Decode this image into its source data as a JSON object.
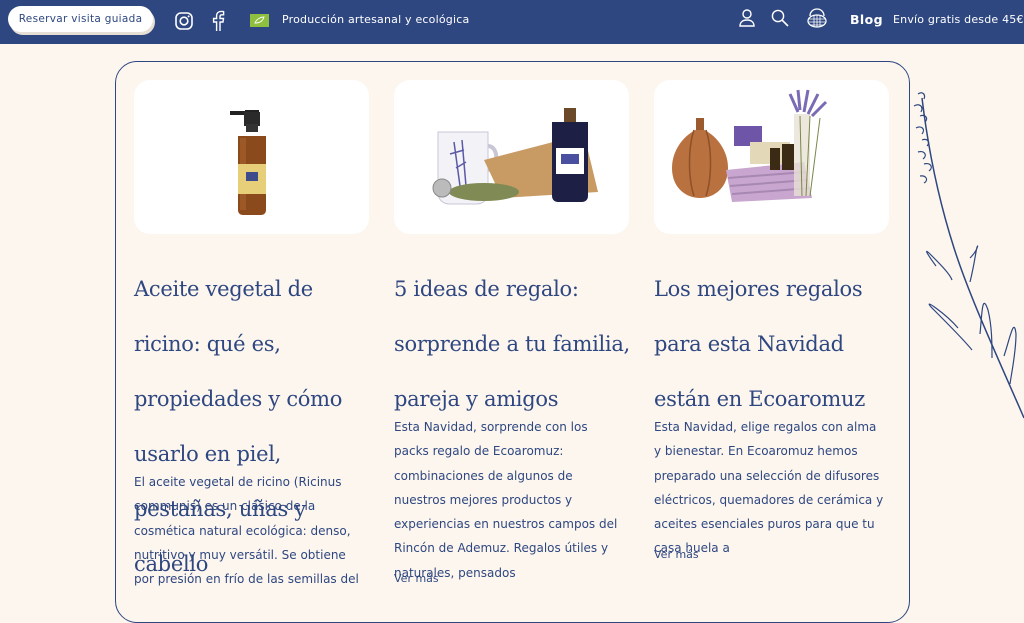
{
  "header": {
    "visit_button": "Reservar visita guiada",
    "tagline": "Producción artesanal y ecológica",
    "blog": "Blog",
    "shipping": "Envío gratis desde 45€",
    "icons": [
      "instagram-icon",
      "facebook-icon",
      "eu-organic-leaf-icon",
      "user-icon",
      "search-icon",
      "basket-icon"
    ]
  },
  "posts": [
    {
      "title": "Aceite vegetal de ricino: qué es, propiedades y cómo usarlo en piel, pestañas, uñas y cabello",
      "excerpt": "El aceite vegetal de ricino (Ricinus communis) es un clásico de la cosmética natural ecológica: denso, nutritivo y muy versátil. Se obtiene por presión en frío de las semillas del"
    },
    {
      "title": "5 ideas de regalo: sorprende a tu familia, pareja y amigos",
      "excerpt": "Esta Navidad, sorprende con los packs regalo de Ecoaromuz: combinaciones de algunos de nuestros mejores productos y experiencias en nuestros campos del Rincón de Ademuz. Regalos útiles y naturales, pensados",
      "more": "Ver más"
    },
    {
      "title": "Los mejores regalos para esta Navidad están en Ecoaromuz",
      "excerpt": "Esta Navidad, elige regalos con alma y bienestar. En Ecoaromuz hemos preparado una selección de difusores eléctricos, quemadores de cerámica y aceites esenciales puros para que tu casa huela a",
      "more": "Ver más"
    }
  ],
  "colors": {
    "brand": "#2e4780",
    "background": "#fdf6ee",
    "card": "#ffffff"
  }
}
